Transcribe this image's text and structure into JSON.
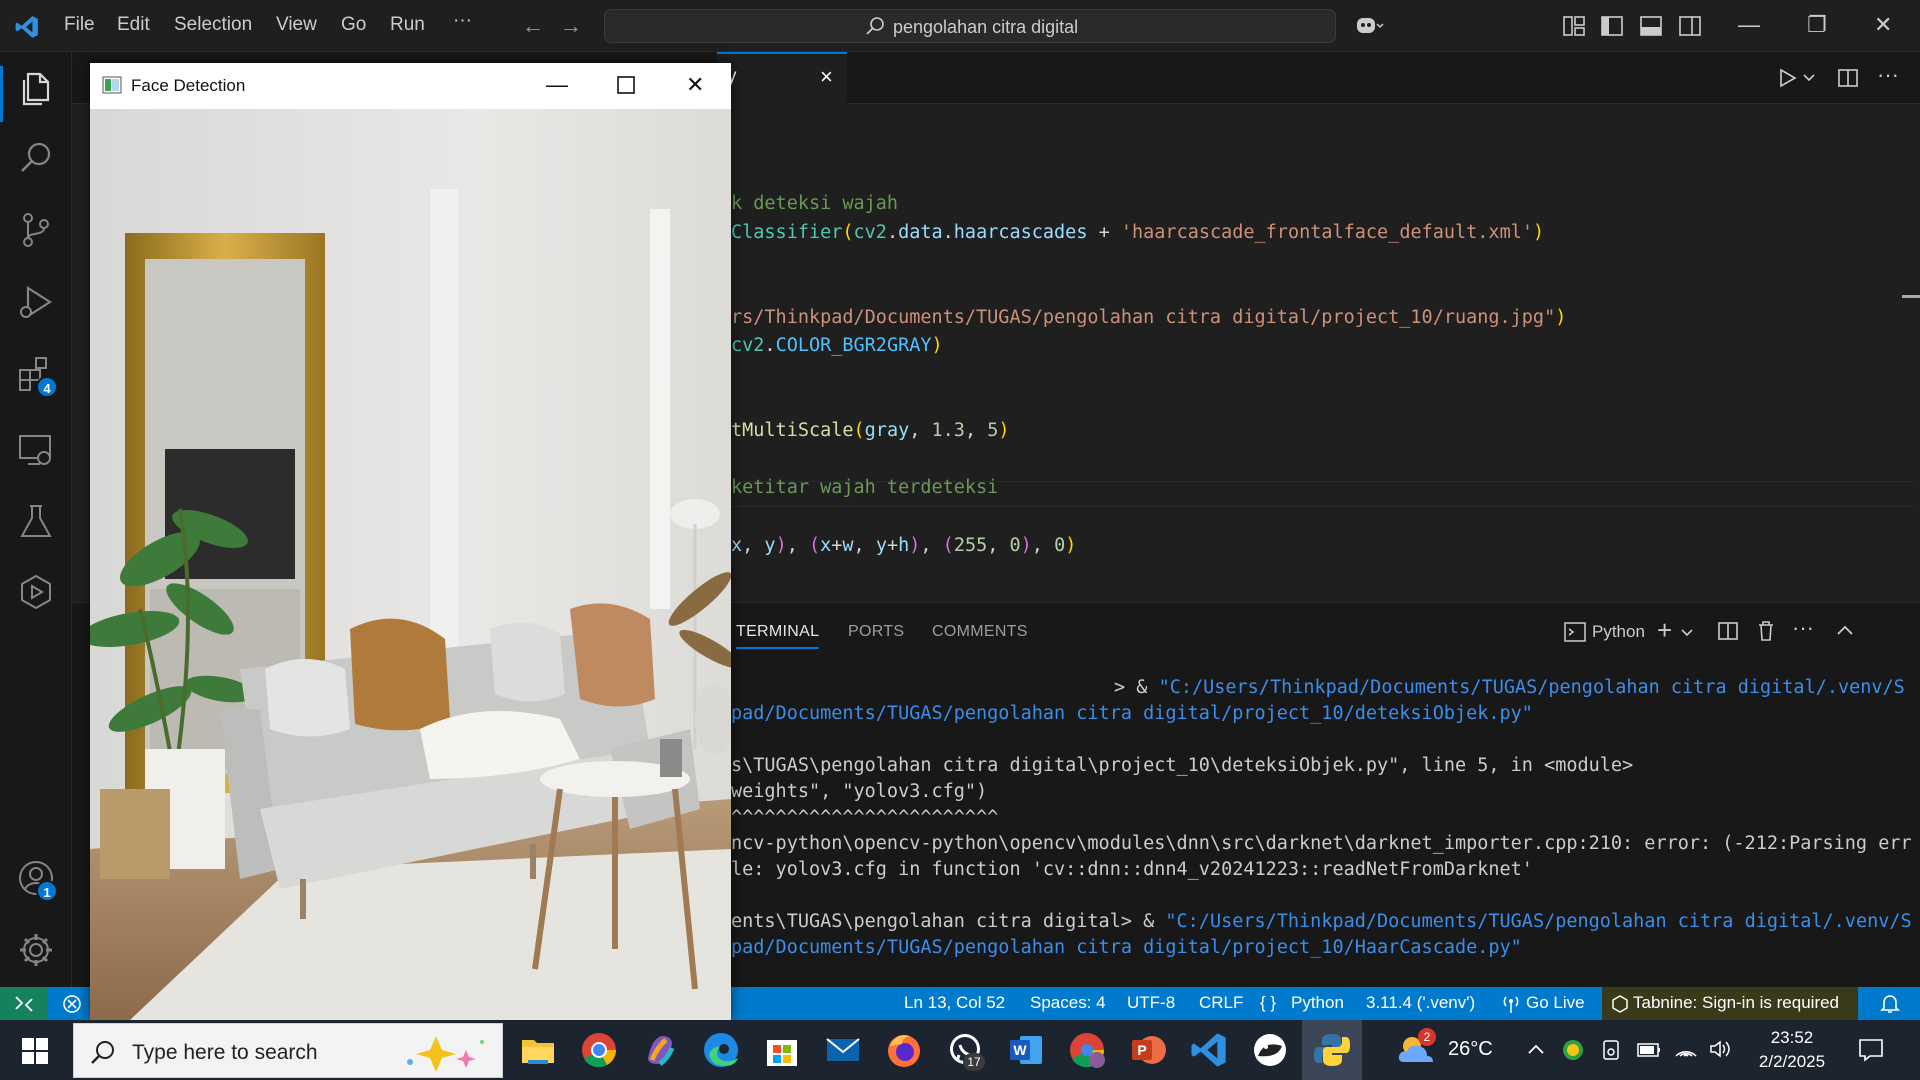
{
  "titlebar": {
    "menu": [
      "File",
      "Edit",
      "Selection",
      "View",
      "Go",
      "Run",
      "···"
    ],
    "command_center": "pengolahan citra digital"
  },
  "activity_bar": {
    "icons": [
      "explorer-icon",
      "search-icon",
      "source-control-icon",
      "run-debug-icon",
      "extensions-icon",
      "remote-explorer-icon",
      "testing-icon",
      "deployment-icon",
      "accounts-icon",
      "manage-gear-icon"
    ],
    "extensions_badge": "4",
    "accounts_badge": "1"
  },
  "editor": {
    "tab_label": "y",
    "tab_close": "×",
    "code_lines": [
      {
        "tokens": [
          {
            "t": "k deteksi wajah",
            "c": "tok-comment"
          }
        ]
      },
      {
        "tokens": [
          {
            "t": "Classifier",
            "c": "tok-cls"
          },
          {
            "t": "(",
            "c": "tok-p1"
          },
          {
            "t": "cv2",
            "c": "tok-cls"
          },
          {
            "t": ".",
            "c": "tok-txt"
          },
          {
            "t": "data",
            "c": "tok-var"
          },
          {
            "t": ".",
            "c": "tok-txt"
          },
          {
            "t": "haarcascades",
            "c": "tok-var"
          },
          {
            "t": " + ",
            "c": "tok-txt"
          },
          {
            "t": "'haarcascade_frontalface_default.xml'",
            "c": "tok-str"
          },
          {
            "t": ")",
            "c": "tok-p1"
          }
        ]
      },
      {
        "tokens": [
          {
            "t": "rs/Thinkpad/Documents/TUGAS/pengolahan citra digital/project_10/ruang.jpg\"",
            "c": "tok-str"
          },
          {
            "t": ")",
            "c": "tok-p1"
          }
        ]
      },
      {
        "tokens": [
          {
            "t": "cv2",
            "c": "tok-cls"
          },
          {
            "t": ".",
            "c": "tok-txt"
          },
          {
            "t": "COLOR_BGR2GRAY",
            "c": "tok-const"
          },
          {
            "t": ")",
            "c": "tok-p1"
          }
        ]
      },
      {
        "tokens": [
          {
            "t": "tMultiScale",
            "c": "tok-fn"
          },
          {
            "t": "(",
            "c": "tok-p1"
          },
          {
            "t": "gray",
            "c": "tok-var"
          },
          {
            "t": ", ",
            "c": "tok-txt"
          },
          {
            "t": "1.3",
            "c": "tok-num"
          },
          {
            "t": ", ",
            "c": "tok-txt"
          },
          {
            "t": "5",
            "c": "tok-num"
          },
          {
            "t": ")",
            "c": "tok-p1"
          }
        ]
      },
      {
        "tokens": [
          {
            "t": "ketitar wajah terdeteksi",
            "c": "tok-comment"
          }
        ]
      },
      {
        "tokens": [
          {
            "t": "x",
            "c": "tok-var"
          },
          {
            "t": ", ",
            "c": "tok-txt"
          },
          {
            "t": "y",
            "c": "tok-var"
          },
          {
            "t": ")",
            "c": "tok-p2"
          },
          {
            "t": ", ",
            "c": "tok-txt"
          },
          {
            "t": "(",
            "c": "tok-p2"
          },
          {
            "t": "x",
            "c": "tok-var"
          },
          {
            "t": "+",
            "c": "tok-txt"
          },
          {
            "t": "w",
            "c": "tok-var"
          },
          {
            "t": ", ",
            "c": "tok-txt"
          },
          {
            "t": "y",
            "c": "tok-var"
          },
          {
            "t": "+",
            "c": "tok-txt"
          },
          {
            "t": "h",
            "c": "tok-var"
          },
          {
            "t": ")",
            "c": "tok-p2"
          },
          {
            "t": ", ",
            "c": "tok-txt"
          },
          {
            "t": "(",
            "c": "tok-p2"
          },
          {
            "t": "255",
            "c": "tok-num"
          },
          {
            "t": ", ",
            "c": "tok-txt"
          },
          {
            "t": "0",
            "c": "tok-num"
          },
          {
            "t": ")",
            "c": "tok-p2"
          },
          {
            "t": ", ",
            "c": "tok-txt"
          },
          {
            "t": "0",
            "c": "tok-num"
          },
          {
            "t": ")",
            "c": "tok-p1"
          }
        ]
      }
    ]
  },
  "panel": {
    "tabs": [
      "TERMINAL",
      "PORTS",
      "COMMENTS"
    ],
    "terminal_profile": "Python",
    "terminal_lines": [
      [
        {
          "t": "> & ",
          "c": ""
        },
        {
          "t": "\"C:/Users/Thinkpad/Documents/TUGAS/pengolahan citra digital/.venv/S",
          "c": "term-path"
        }
      ],
      [
        {
          "t": "pad/Documents/TUGAS/pengolahan citra digital/project_10/deteksiObjek.py\"",
          "c": "term-path"
        }
      ],
      [
        {
          "t": "s\\TUGAS\\pengolahan citra digital\\project_10\\deteksiObjek.py\", line 5, in <module>",
          "c": ""
        }
      ],
      [
        {
          "t": "weights\", \"yolov3.cfg\")",
          "c": ""
        }
      ],
      [
        {
          "t": "^^^^^^^^^^^^^^^^^^^^^^^^",
          "c": ""
        }
      ],
      [
        {
          "t": "ncv-python\\opencv-python\\opencv\\modules\\dnn\\src\\darknet\\darknet_importer.cpp:210: error: (-212:Parsing err",
          "c": ""
        }
      ],
      [
        {
          "t": "le: yolov3.cfg in function 'cv::dnn::dnn4_v20241223::readNetFromDarknet'",
          "c": ""
        }
      ],
      [
        {
          "t": "ents\\TUGAS\\pengolahan citra digital> & ",
          "c": ""
        },
        {
          "t": "\"C:/Users/Thinkpad/Documents/TUGAS/pengolahan citra digital/.venv/S",
          "c": "term-path"
        }
      ],
      [
        {
          "t": "pad/Documents/TUGAS/pengolahan citra digital/project_10/HaarCascade.py\"",
          "c": "term-path"
        }
      ]
    ]
  },
  "statusbar": {
    "position": "Ln 13, Col 52",
    "spaces": "Spaces: 4",
    "encoding": "UTF-8",
    "eol": "CRLF",
    "language": "Python",
    "interpreter": "3.11.4 ('.venv')",
    "go_live": "Go Live",
    "tabnine": "Tabnine: Sign-in is required"
  },
  "face_window": {
    "title": "Face Detection"
  },
  "taskbar": {
    "search_placeholder": "Type here to search",
    "apps": [
      "file-explorer-icon",
      "chrome-icon",
      "copilot-icon",
      "edge-icon",
      "microsoft-store-icon",
      "mail-icon",
      "firefox-icon",
      "whatsapp-icon",
      "word-icon",
      "chrome-profile-icon",
      "powerpoint-icon",
      "vscode-icon",
      "game-icon",
      "python-icon"
    ],
    "whatsapp_badge": "17",
    "weather_badge": "2",
    "temperature": "26°C",
    "time": "23:52",
    "date": "2/2/2025"
  }
}
